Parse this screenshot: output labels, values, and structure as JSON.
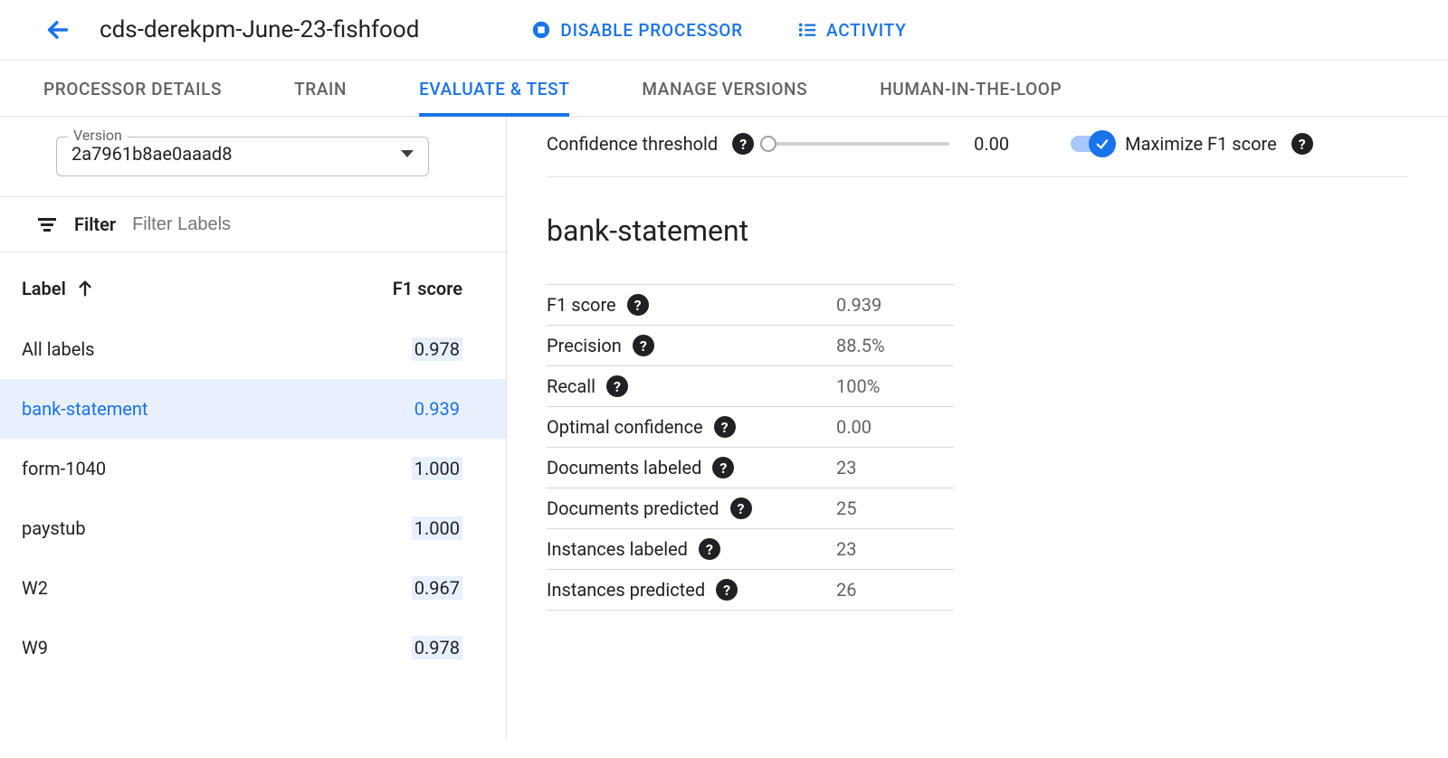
{
  "colors": {
    "primary": "#1a73e8"
  },
  "header": {
    "title": "cds-derekpm-June-23-fishfood",
    "disable_label": "DISABLE PROCESSOR",
    "activity_label": "ACTIVITY"
  },
  "tabs": [
    {
      "label": "PROCESSOR DETAILS",
      "active": false
    },
    {
      "label": "TRAIN",
      "active": false
    },
    {
      "label": "EVALUATE & TEST",
      "active": true
    },
    {
      "label": "MANAGE VERSIONS",
      "active": false
    },
    {
      "label": "HUMAN-IN-THE-LOOP",
      "active": false
    }
  ],
  "version": {
    "legend": "Version",
    "value": "2a7961b8ae0aaad8"
  },
  "filter": {
    "label": "Filter",
    "placeholder": "Filter Labels"
  },
  "table": {
    "header_label": "Label",
    "header_f1": "F1 score",
    "rows": [
      {
        "label": "All labels",
        "f1": "0.978",
        "selected": false
      },
      {
        "label": "bank-statement",
        "f1": "0.939",
        "selected": true
      },
      {
        "label": "form-1040",
        "f1": "1.000",
        "selected": false
      },
      {
        "label": "paystub",
        "f1": "1.000",
        "selected": false
      },
      {
        "label": "W2",
        "f1": "0.967",
        "selected": false
      },
      {
        "label": "W9",
        "f1": "0.978",
        "selected": false
      }
    ]
  },
  "controls": {
    "confidence_label": "Confidence threshold",
    "confidence_value": "0.00",
    "max_f1_label": "Maximize F1 score",
    "max_f1_on": true
  },
  "detail": {
    "title": "bank-statement",
    "metrics": [
      {
        "label": "F1 score",
        "value": "0.939"
      },
      {
        "label": "Precision",
        "value": "88.5%"
      },
      {
        "label": "Recall",
        "value": "100%"
      },
      {
        "label": "Optimal confidence",
        "value": "0.00"
      },
      {
        "label": "Documents labeled",
        "value": "23"
      },
      {
        "label": "Documents predicted",
        "value": "25"
      },
      {
        "label": "Instances labeled",
        "value": "23"
      },
      {
        "label": "Instances predicted",
        "value": "26"
      }
    ]
  }
}
